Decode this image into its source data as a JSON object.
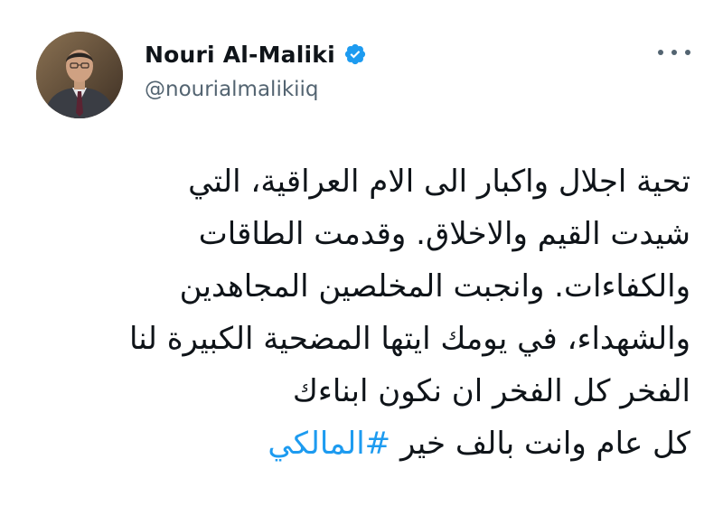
{
  "author": {
    "display_name": "Nouri Al-Maliki",
    "handle": "@nourialmalikiiq",
    "verified": true,
    "verified_color": "#1d9bf0"
  },
  "tweet": {
    "lines": [
      "تحية اجلال واكبار الى الام العراقية، التي",
      "شيدت القيم والاخلاق. وقدمت الطاقات",
      "والكفاءات. وانجبت المخلصين المجاهدين",
      "والشهداء، في يومك ايتها المضحية الكبيرة لنا",
      "الفخر كل الفخر ان نكون ابناءك",
      "كل عام وانت بالف خير"
    ],
    "hashtag": "#المالكي"
  },
  "colors": {
    "text": "#0f1419",
    "secondary": "#536471",
    "link": "#1d9bf0"
  },
  "icons": {
    "verified": "verified-badge-icon",
    "more": "more-options-icon"
  }
}
